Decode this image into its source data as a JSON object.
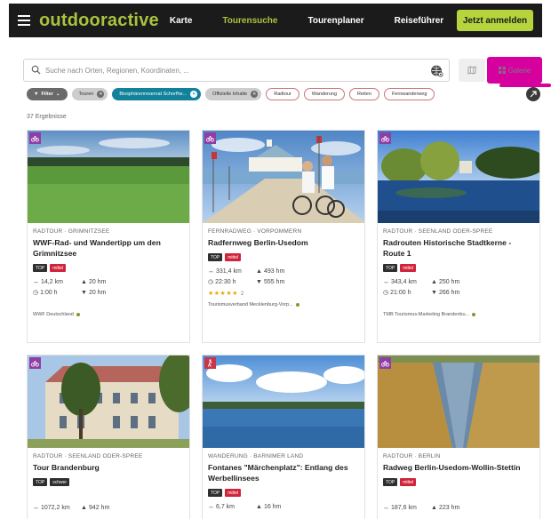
{
  "topbar": {
    "logo": "outdooractive",
    "nav": [
      "Karte",
      "Tourensuche",
      "Tourenplaner",
      "Reiseführer"
    ],
    "active_nav": "Tourensuche",
    "login": "Jetzt anmelden"
  },
  "search": {
    "placeholder": "Suche nach Orten, Regionen, Koordinaten, ...",
    "gallery_label": "Galerie"
  },
  "chips": {
    "filter": "Filter",
    "touren": "Touren",
    "biosphere": "Biosphärenreservat Schorfhe...",
    "official": "Offizielle Inhalte",
    "radtour": "Radtour",
    "wanderung": "Wanderung",
    "reiten": "Reiten",
    "fernwanderweg": "Fernwanderweg"
  },
  "results_count": "37 Ergebnisse",
  "cards": [
    {
      "category": "RADTOUR · GRIMNITZSEE",
      "title": "WWF-Rad- und Wandertipp um den Grimnitzsee",
      "tags": [
        "TOP",
        "mittel"
      ],
      "distance": "14,2 km",
      "ascent": "20 hm",
      "duration": "1:00 h",
      "descent": "20 hm",
      "author": "WWF Deutschland"
    },
    {
      "category": "FERNRADWEG · VORPOMMERN",
      "title": "Radfernweg Berlin-Usedom",
      "tags": [
        "TOP",
        "mittel"
      ],
      "distance": "331,4 km",
      "ascent": "493 hm",
      "duration": "22:30 h",
      "descent": "555 hm",
      "stars": "★★★★★",
      "rating_count": "2",
      "author": "Tourismusverband Mecklenburg-Vorp..."
    },
    {
      "category": "RADTOUR · SEENLAND ODER-SPREE",
      "title": "Radrouten Historische Stadtkerne - Route 1",
      "tags": [
        "TOP",
        "mittel"
      ],
      "distance": "343,4 km",
      "ascent": "250 hm",
      "duration": "21:00 h",
      "descent": "266 hm",
      "author": "TMB Tourismus-Marketing Brandenbu..."
    },
    {
      "category": "RADTOUR · SEENLAND ODER-SPREE",
      "title": "Tour Brandenburg",
      "tags": [
        "TOP",
        "schwer"
      ],
      "distance": "1072,2 km",
      "ascent": "942 hm"
    },
    {
      "category": "WANDERUNG · BARNIMER LAND",
      "title": "Fontanes \"Märchenplatz\": Entlang des Werbellinsees",
      "tags": [
        "TOP",
        "mittel"
      ],
      "distance": "6,7 km",
      "ascent": "16 hm"
    },
    {
      "category": "RADTOUR · BERLIN",
      "title": "Radweg Berlin-Usedom-Wollin-Stettin",
      "tags": [
        "TOP",
        "mittel"
      ],
      "distance": "187,6 km",
      "ascent": "223 hm"
    }
  ],
  "colors": {
    "brand_green": "#a9c23f",
    "gallery_magenta": "#d6009f",
    "badge_purple": "#8e3ea4",
    "tag_red": "#d0243b"
  }
}
